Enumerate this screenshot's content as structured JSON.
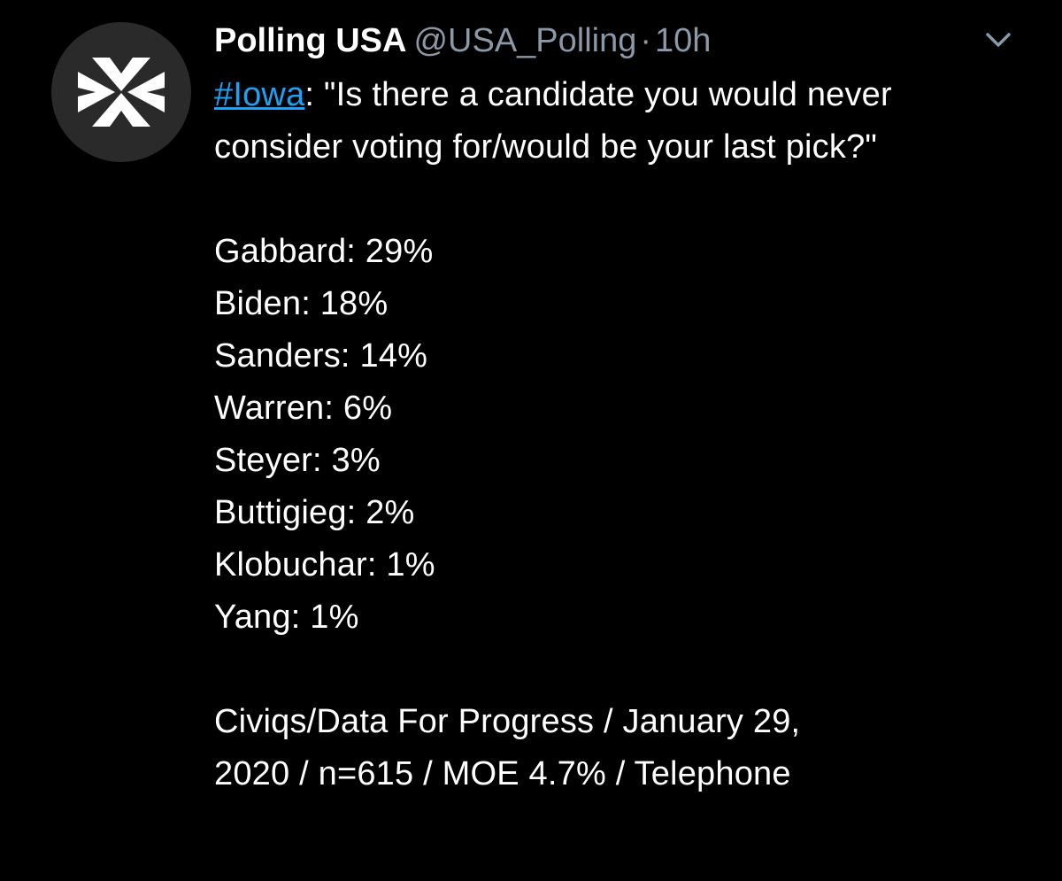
{
  "tweet": {
    "display_name": "Polling USA",
    "handle": "@USA_Polling",
    "separator": "·",
    "time": "10h",
    "hashtag": "#Iowa",
    "question_rest": ": \"Is there a candidate you would never consider voting for/would be your last pick?\"",
    "results": [
      {
        "text": "Gabbard: 29%"
      },
      {
        "text": "Biden: 18%"
      },
      {
        "text": "Sanders: 14%"
      },
      {
        "text": "Warren: 6%"
      },
      {
        "text": "Steyer: 3%"
      },
      {
        "text": "Buttigieg: 2%"
      },
      {
        "text": "Klobuchar: 1%"
      },
      {
        "text": "Yang: 1%"
      }
    ],
    "source_line1": "Civiqs/Data For Progress / January 29,",
    "source_line2": "2020 / n=615 / MOE 4.7% / Telephone"
  },
  "icons": {
    "avatar": "polling-usa-x-logo",
    "menu": "chevron-down-icon"
  },
  "colors": {
    "background": "#000000",
    "text": "#ffffff",
    "secondary": "#8b98a5",
    "link": "#1da1f2",
    "avatar_bg": "#2a2a2a"
  }
}
